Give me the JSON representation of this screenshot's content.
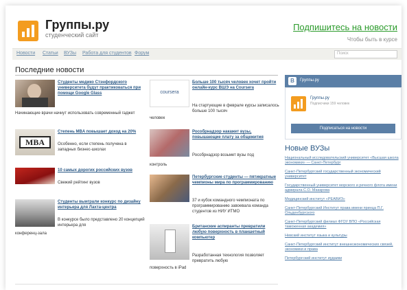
{
  "header": {
    "site_title": "Группы.ру",
    "site_subtitle": "студенческий сайт",
    "subscribe_link": "Подпишитесь на новости",
    "tagline": "Чтобы быть в курсе"
  },
  "colors": {
    "brand_orange": "#f39c1f",
    "vk_blue": "#5b7fa6",
    "subscribe_green": "#2a9a2a",
    "link_blue": "#2a5885"
  },
  "nav": {
    "items": [
      "Новости",
      "Статьи",
      "ВУЗы",
      "Работа для студентов",
      "Форум"
    ],
    "search_placeholder": "Поиск"
  },
  "main": {
    "section_title": "Последние новости",
    "news": [
      {
        "thumb_icon": "person-photo",
        "headline": "Студенты медико Стэнфордского университета будут практиковаться при помощи Google Glass",
        "desc": "",
        "tail": "Начинающие врачи начнут использовать современный гаджет"
      },
      {
        "thumb_icon": "coursera-logo",
        "thumb_text": "coursera",
        "headline": "Больше 100 тысяч человек хочет пройти онлайн-курс ВШЭ на Coursera",
        "desc": "На стартующие в феврале курсы записалось больше 100 тысяч",
        "tail": "человек"
      },
      {
        "thumb_icon": "mba-sign",
        "thumb_text": "MBA",
        "headline": "Степень MBA повышает доход на 20%",
        "desc": "Особенно, если степень получена в западных бизнес-школах",
        "tail": ""
      },
      {
        "thumb_icon": "protest-photo",
        "headline": "Рособрнадзор накажет вузы, повышающие плату за общежития",
        "desc": "Рособрнадзор возьмет вузы под",
        "tail": "контроль"
      },
      {
        "thumb_icon": "banknotes-photo",
        "headline": "10 самых дорогих российских вузов",
        "desc": "Свежий рейтинг вузов",
        "tail": ""
      },
      {
        "thumb_icon": "programmers-photo",
        "headline": "Петербургские студенты — пятикратные чемпионы мира по программированию",
        "desc": "37 и кубок командного чемпионата по программированию завоевала команда студентов из НИУ ИТМО",
        "tail": ""
      },
      {
        "thumb_icon": "interior-photo",
        "headline": "Студенты выиграли конкурс по дизайну интерьера для Лахта-центра",
        "desc": "В конкурсе было представлено 20 концепций интерьера для",
        "tail": "конференц-зала"
      },
      {
        "thumb_icon": "tablet-photo",
        "headline": "Британские аспиранты превратили любую поверхность в планшетный компьютер",
        "desc": "Разработанная технология позволяет превратить любую",
        "tail": "поверхность в iPad"
      }
    ]
  },
  "sidebar": {
    "vk_widget": {
      "logo_letter": "В",
      "title": "Группы.ру",
      "group_name": "Группы.ру",
      "members": "Подписчики 159 человек",
      "join_button": "Подписаться на новости"
    },
    "new_universities_title": "Новые ВУЗы",
    "universities": [
      "Национальный исследовательский университет «Высшая школа экономики» — Санкт-Петербург",
      "Санкт-Петербургский государственный экономический университет",
      "Государственный университет морского и речного флота имени адмирала С.О. Макарова",
      "Медицинский институт «РЕАВИЗ»",
      "Санкт-Петербургский Институт права имени принца П.Г. Ольденбургского",
      "Санкт-Петербургский филиал ФГОУ ВПО «Российская таможенная академия»",
      "Невский институт языка и культуры",
      "Санкт-Петербургский институт внешнеэкономических связей, экономики и права",
      "Петербургский институт иудаики"
    ]
  }
}
